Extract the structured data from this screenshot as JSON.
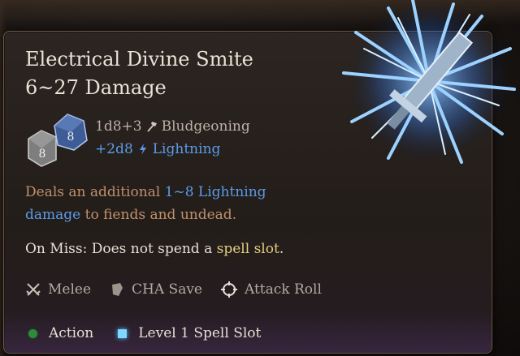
{
  "tooltip": {
    "title": "Electrical Divine Smite",
    "damage_range": "6~27 Damage",
    "damage_rows": [
      {
        "dice": "1d8+3",
        "type": "Bludgeoning",
        "icon": "hammer-icon",
        "color": "#b9b1a6"
      },
      {
        "dice": "+2d8",
        "type": "Lightning",
        "icon": "lightning-icon",
        "color": "#5b9be8"
      }
    ],
    "dice_icons": [
      {
        "face": "8",
        "color": "#8a8a8a"
      },
      {
        "face": "8",
        "color": "#4f6fa8"
      }
    ],
    "description": {
      "part1": "Deals an additional ",
      "highlight": "1~8 Lightning damage",
      "part2": " to fiends and undead."
    },
    "on_miss": {
      "prefix": "On Miss: Does not spend a ",
      "highlight": "spell slot",
      "suffix": "."
    },
    "tags": [
      {
        "label": "Melee",
        "icon": "crossed-swords-icon"
      },
      {
        "label": "CHA Save",
        "icon": "shield-icon"
      },
      {
        "label": "Attack Roll",
        "icon": "crosshair-icon"
      }
    ],
    "costs": [
      {
        "label": "Action",
        "icon": "action-dot-icon",
        "color": "#2f8a3c"
      },
      {
        "label": "Level 1 Spell Slot",
        "icon": "spell-slot-icon",
        "color": "#7fd6ff"
      }
    ]
  },
  "colors": {
    "accent_blue": "#5b9be8",
    "description_orange": "#c0906a",
    "spell_slot_gold": "#e3cf7e",
    "border": "#6f5a45"
  },
  "spell_art": {
    "icon": "divine-smite-lightning-sword-icon"
  }
}
